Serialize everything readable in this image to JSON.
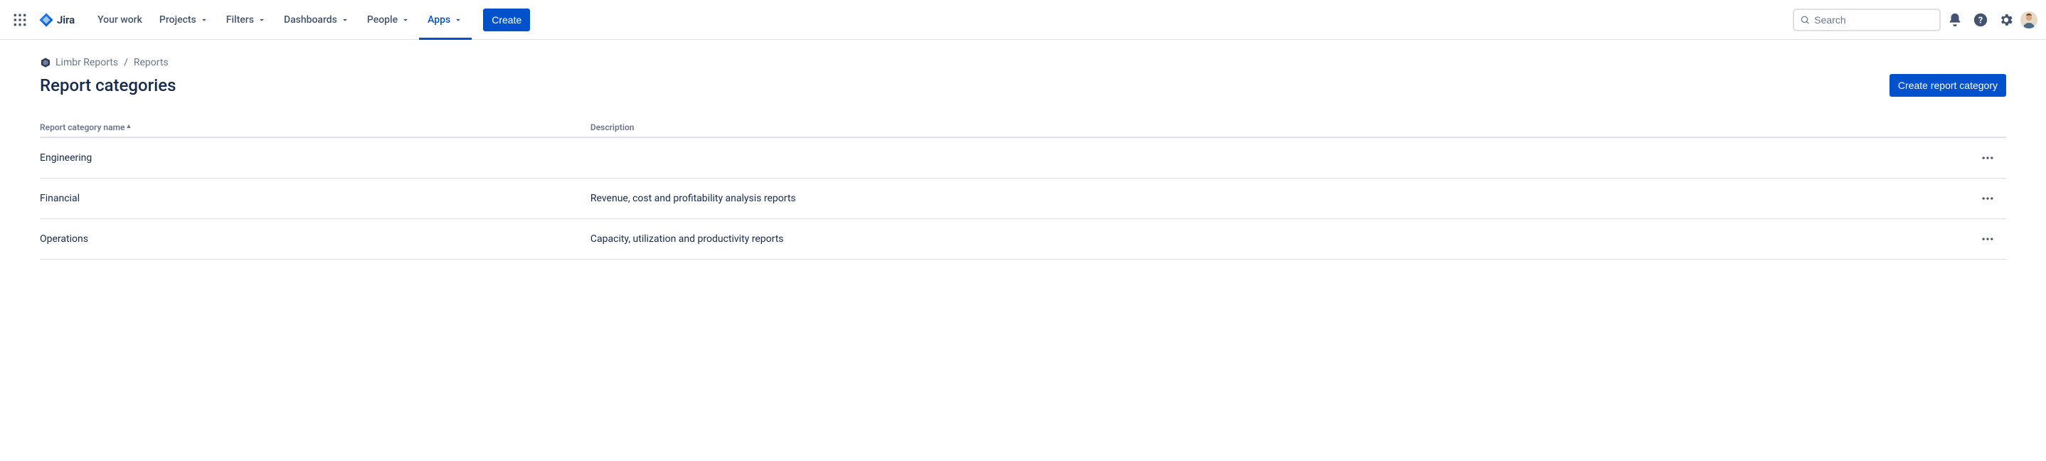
{
  "product": "Jira",
  "nav": {
    "your_work": "Your work",
    "projects": "Projects",
    "filters": "Filters",
    "dashboards": "Dashboards",
    "people": "People",
    "apps": "Apps",
    "create": "Create"
  },
  "search": {
    "placeholder": "Search"
  },
  "breadcrumb": {
    "app": "Limbr Reports",
    "section": "Reports"
  },
  "page_title": "Report categories",
  "create_category_btn": "Create report category",
  "table": {
    "col_name": "Report category name",
    "col_desc": "Description",
    "rows": [
      {
        "name": "Engineering",
        "desc": ""
      },
      {
        "name": "Financial",
        "desc": "Revenue, cost and profitability analysis reports"
      },
      {
        "name": "Operations",
        "desc": "Capacity, utilization and productivity reports"
      }
    ]
  }
}
